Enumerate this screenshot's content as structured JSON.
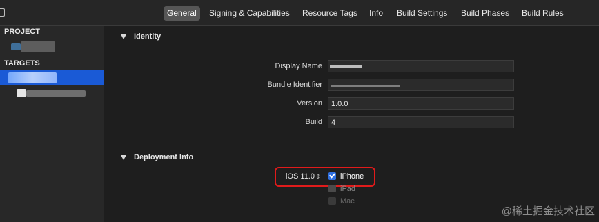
{
  "tabs": [
    {
      "label": "General",
      "active": true
    },
    {
      "label": "Signing & Capabilities"
    },
    {
      "label": "Resource Tags"
    },
    {
      "label": "Info"
    },
    {
      "label": "Build Settings"
    },
    {
      "label": "Build Phases"
    },
    {
      "label": "Build Rules"
    }
  ],
  "sidebar": {
    "project_header": "PROJECT",
    "targets_header": "TARGETS",
    "selected_color": "#1a5ad6"
  },
  "identity": {
    "title": "Identity",
    "display_name_label": "Display Name",
    "bundle_identifier_label": "Bundle Identifier",
    "version_label": "Version",
    "version_value": "1.0.0",
    "build_label": "Build",
    "build_value": "4"
  },
  "deployment": {
    "title": "Deployment Info",
    "ios_version": "iOS 11.0",
    "devices": [
      {
        "label": "iPhone",
        "checked": true
      },
      {
        "label": "iPad",
        "checked": false
      },
      {
        "label": "Mac",
        "checked": false
      }
    ],
    "highlight_color": "#e01b1b"
  },
  "watermark": "@稀土掘金技术社区"
}
